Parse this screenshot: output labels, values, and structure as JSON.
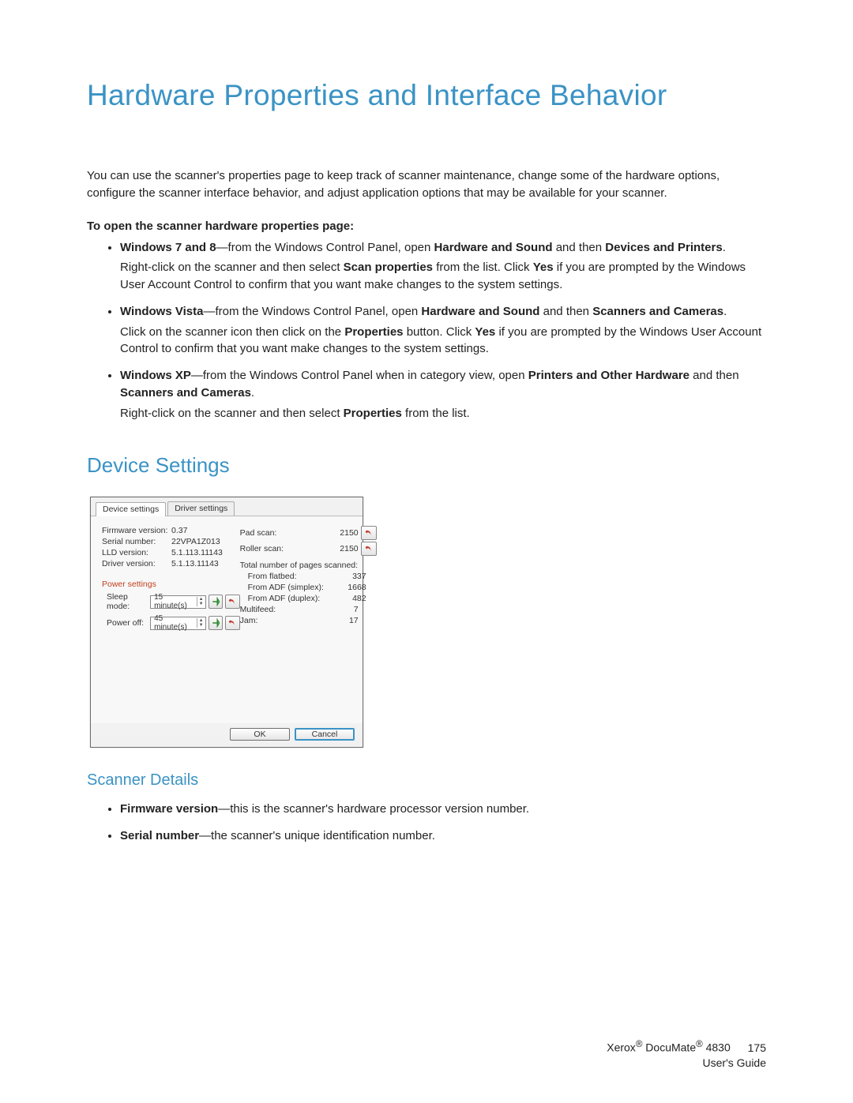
{
  "title": "Hardware Properties and Interface Behavior",
  "intro": "You can use the scanner's properties page to keep track of scanner maintenance, change some of the hardware options, configure the scanner interface behavior, and adjust application options that may be available for your scanner.",
  "instruction_heading": "To open the scanner hardware properties page:",
  "bullets": {
    "w78_pre": "Windows 7 and 8",
    "w78_mid1": "—from the Windows Control Panel, open ",
    "w78_b1": "Hardware and Sound",
    "w78_mid2": " and then ",
    "w78_b2": "Devices and Printers",
    "w78_end": ".",
    "w78_p1": "Right-click on the scanner and then select ",
    "w78_p1b": "Scan properties",
    "w78_p1c": " from the list. Click ",
    "w78_p1d": "Yes",
    "w78_p1e": " if you are prompted by the Windows User Account Control to confirm that you want make changes to the system settings.",
    "vista_pre": "Windows Vista",
    "vista_mid1": "—from the Windows Control Panel, open ",
    "vista_b1": "Hardware and Sound",
    "vista_mid2": " and then ",
    "vista_b2": "Scanners and Cameras",
    "vista_end": ".",
    "vista_p1": "Click on the scanner icon then click on the ",
    "vista_p1b": "Properties",
    "vista_p1c": " button. Click ",
    "vista_p1d": "Yes",
    "vista_p1e": " if you are prompted by the Windows User Account Control to confirm that you want make changes to the system settings.",
    "xp_pre": "Windows XP",
    "xp_mid1": "—from the Windows Control Panel when in category view, open ",
    "xp_b1": "Printers and Other Hardware",
    "xp_mid2": " and then ",
    "xp_b2": "Scanners and Cameras",
    "xp_end": ".",
    "xp_p1": "Right-click on the scanner and then select ",
    "xp_p1b": "Properties",
    "xp_p1c": " from the list."
  },
  "section_device_settings": "Device Settings",
  "dialog": {
    "tabs": {
      "device": "Device settings",
      "driver": "Driver settings"
    },
    "left": {
      "firmware_lbl": "Firmware version:",
      "firmware_val": "0.37",
      "serial_lbl": "Serial number:",
      "serial_val": "22VPA1Z013",
      "lld_lbl": "LLD version:",
      "lld_val": "5.1.113.11143",
      "driver_lbl": "Driver version:",
      "driver_val": "5.1.13.11143",
      "power_heading": "Power settings",
      "sleep_lbl": "Sleep mode:",
      "sleep_val": "15 minute(s)",
      "poweroff_lbl": "Power off:",
      "poweroff_val": "45 minute(s)"
    },
    "right": {
      "pad_lbl": "Pad scan:",
      "pad_val": "2150",
      "roller_lbl": "Roller scan:",
      "roller_val": "2150",
      "total_heading": "Total number of pages scanned:",
      "flat_lbl": "From flatbed:",
      "flat_val": "337",
      "adfs_lbl": "From ADF (simplex):",
      "adfs_val": "1668",
      "adfd_lbl": "From ADF (duplex):",
      "adfd_val": "482",
      "multi_lbl": "Multifeed:",
      "multi_val": "7",
      "jam_lbl": "Jam:",
      "jam_val": "17"
    },
    "ok": "OK",
    "cancel": "Cancel"
  },
  "section_scanner_details": "Scanner Details",
  "details": {
    "fw_b": "Firmware version",
    "fw_t": "—this is the scanner's hardware processor version number.",
    "sn_b": "Serial number",
    "sn_t": "—the scanner's unique identification number."
  },
  "footer": {
    "line1_a": "Xerox",
    "line1_reg1": "®",
    "line1_b": " DocuMate",
    "line1_reg2": "®",
    "line1_c": " 4830",
    "page": "175",
    "line2": "User's Guide"
  }
}
